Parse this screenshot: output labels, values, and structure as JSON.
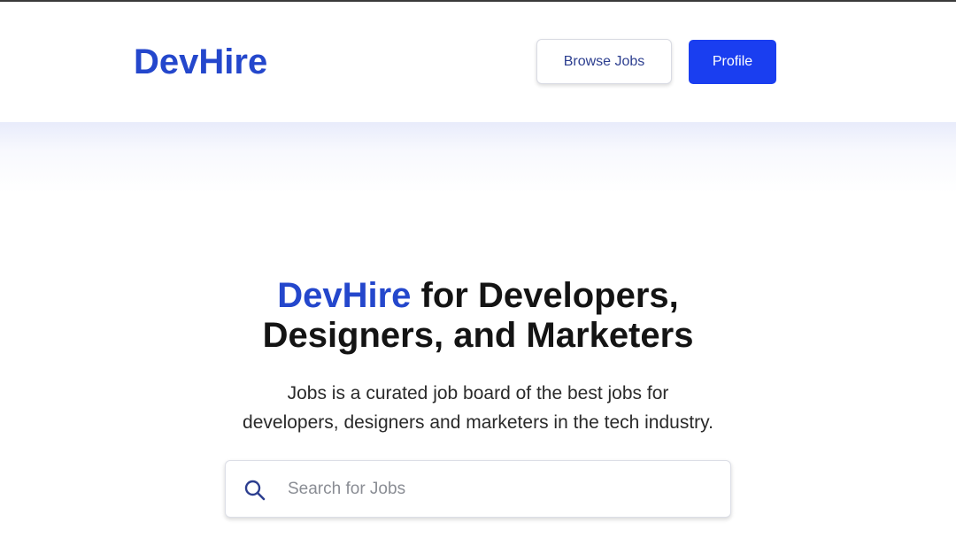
{
  "header": {
    "logo": "DevHire",
    "browse_jobs_label": "Browse Jobs",
    "profile_label": "Profile"
  },
  "hero": {
    "title_brand": "DevHire",
    "title_line1_rest": " for Developers,",
    "title_line2": "Designers, and Marketers",
    "subtitle_line1": "Jobs is a curated job board of the best jobs for",
    "subtitle_line2": "developers, designers and marketers in the tech industry."
  },
  "search": {
    "placeholder": "Search for Jobs",
    "value": "",
    "icon": "search-icon"
  },
  "colors": {
    "brand": "#2447cc",
    "primary_button": "#1a3ef0",
    "text": "#141414"
  }
}
